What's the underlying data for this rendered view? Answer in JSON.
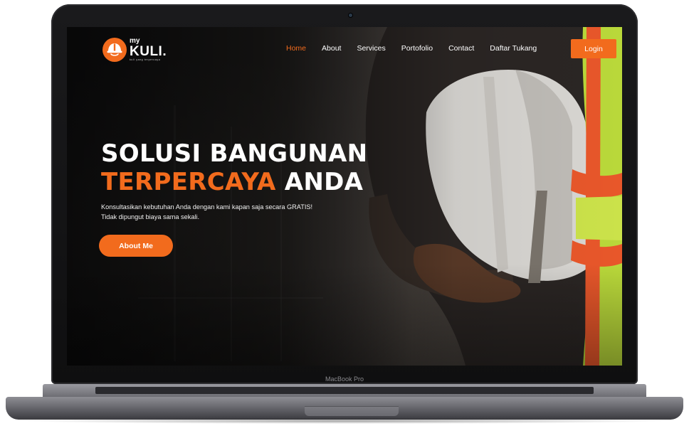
{
  "device": {
    "model_label": "MacBook Pro"
  },
  "brand": {
    "logo_top": "my",
    "logo_main": "KULI.",
    "logo_tagline": "kuli yang terpercaya",
    "accent_color": "#f26b1d"
  },
  "nav": {
    "items": [
      {
        "label": "Home",
        "active": true
      },
      {
        "label": "About",
        "active": false
      },
      {
        "label": "Services",
        "active": false
      },
      {
        "label": "Portofolio",
        "active": false
      },
      {
        "label": "Contact",
        "active": false
      },
      {
        "label": "Daftar Tukang",
        "active": false
      }
    ],
    "login_label": "Login"
  },
  "hero": {
    "title_line1": "SOLUSI BANGUNAN",
    "title_line2_accent": "TERPERCAYA",
    "title_line2_rest": " ANDA",
    "desc_line1": "Konsultasikan kebutuhan Anda dengan kami kapan saja secara GRATIS!",
    "desc_line2": "Tidak dipungut biaya sama sekali.",
    "cta_label": "About Me"
  }
}
